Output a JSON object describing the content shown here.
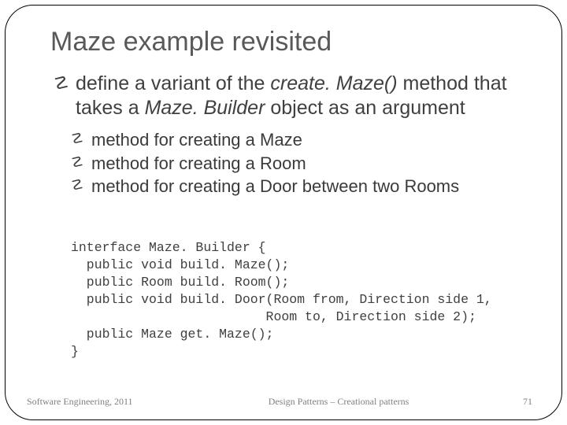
{
  "title": "Maze example revisited",
  "bullet1": {
    "pre": "define a variant of the ",
    "ital1": "create. Maze()",
    "mid": " method that takes a ",
    "ital2": "Maze. Builder",
    "post": " object as an argument"
  },
  "subbullets": {
    "s1": "method for creating a Maze",
    "s2": "method for creating a Room",
    "s3": "method for creating a Door between two Rooms"
  },
  "code": "interface Maze. Builder {\n  public void build. Maze();\n  public Room build. Room();\n  public void build. Door(Room from, Direction side 1,\n                         Room to, Direction side 2);\n  public Maze get. Maze();\n}",
  "footer": {
    "left": "Software Engineering, 2011",
    "center": "Design Patterns – Creational patterns",
    "page": "71"
  },
  "glyph": {
    "curl": "☡"
  }
}
